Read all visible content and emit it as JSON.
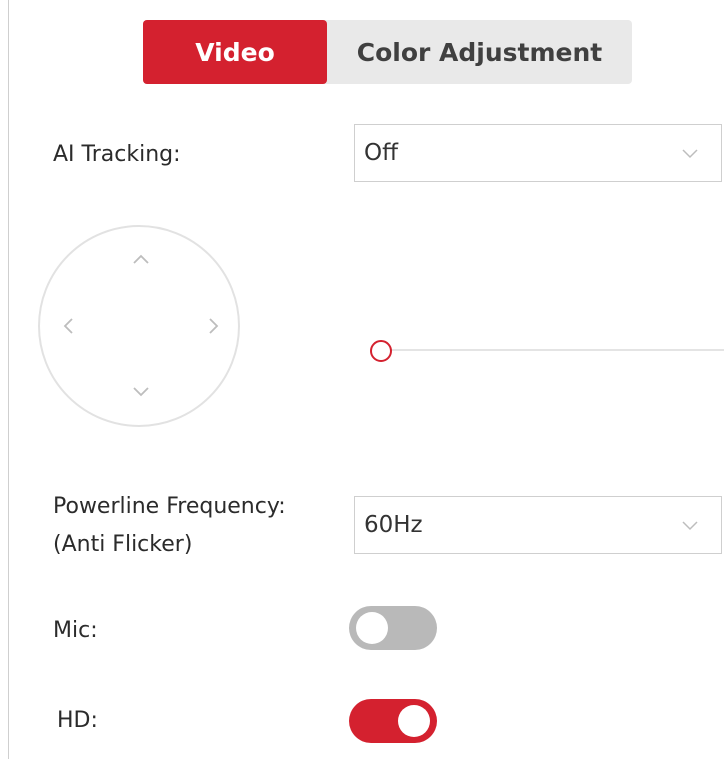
{
  "tabs": [
    {
      "label": "Video",
      "active": true
    },
    {
      "label": "Color Adjustment",
      "active": false
    }
  ],
  "ai_tracking": {
    "label": "AI Tracking:",
    "value": "Off"
  },
  "zoom_slider": {
    "value_fraction": 0.0
  },
  "powerline": {
    "label_line1": "Powerline Frequency:",
    "label_line2": "(Anti Flicker)",
    "value": "60Hz"
  },
  "mic": {
    "label": "Mic:",
    "on": false
  },
  "hd": {
    "label": "HD:",
    "on": true
  },
  "colors": {
    "accent": "#d4212f",
    "toggle_off": "#b9b9b9",
    "tab_bg": "#e9e9e9"
  }
}
